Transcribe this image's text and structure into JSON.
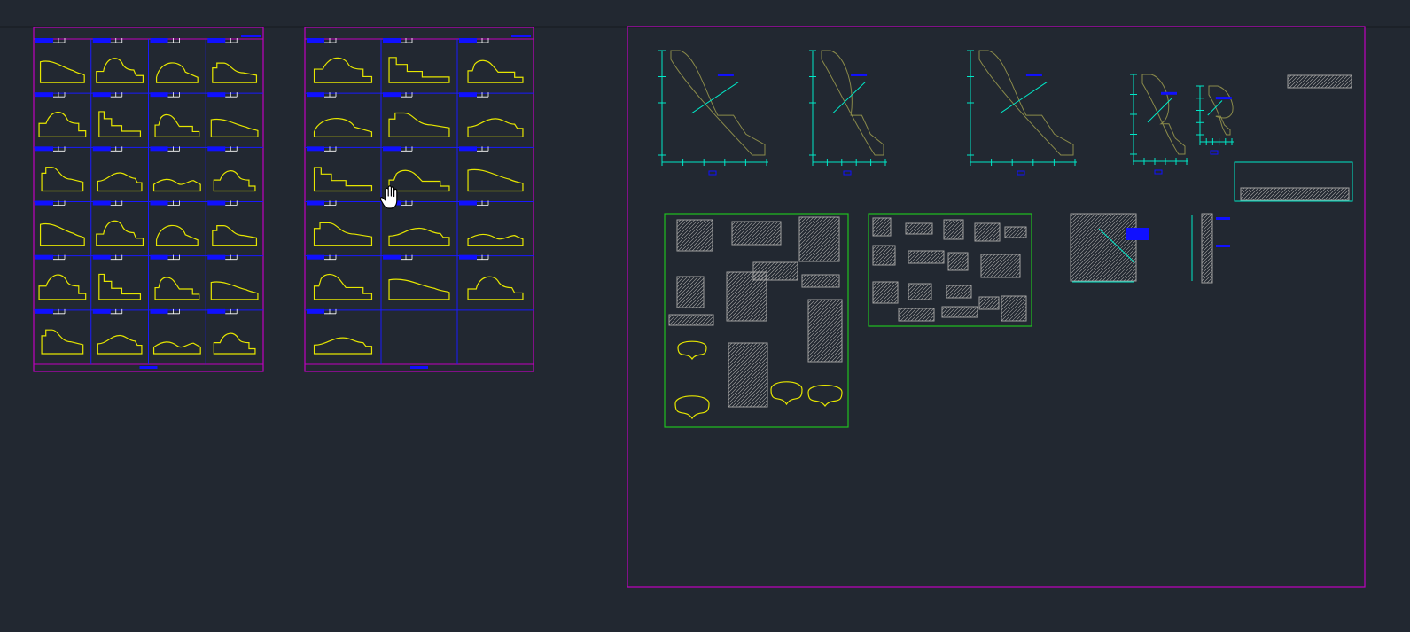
{
  "app": {
    "view": "cad-model-space",
    "pan_cursor": "hand-pan-icon"
  },
  "colors": {
    "background": "#222831",
    "sheet_border": "#c000c0",
    "grid_line": "#1a1aff",
    "profile": "#e6e600",
    "title_tag": "#1010ff",
    "detail_frame": "#20c020",
    "dimension": "#00e8c8",
    "hatch": "#a0a0a0",
    "outline": "#8a8a4a",
    "top_rule": "#000000"
  },
  "sheets": [
    {
      "id": "sheet-a",
      "columns": 4,
      "rows": 6,
      "filled_cells": 24
    },
    {
      "id": "sheet-b",
      "columns": 3,
      "rows": 6,
      "filled_cells": 16
    }
  ],
  "layout_frame": {
    "large_profiles": 6,
    "detail_groups": 2,
    "section_details": 2
  }
}
